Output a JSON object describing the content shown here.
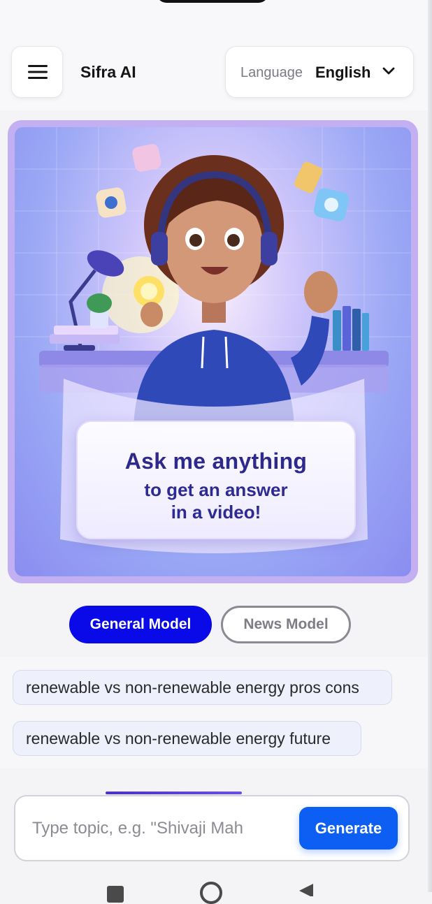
{
  "header": {
    "brand": "Sifra AI",
    "menu_icon": "hamburger-menu-icon",
    "language_label": "Language",
    "language_value": "English",
    "dropdown_icon": "chevron-down-icon"
  },
  "hero": {
    "line1": "Ask me anything",
    "line2": "to get an answer",
    "line3": "in a video!"
  },
  "models": {
    "general_label": "General Model",
    "news_label": "News Model",
    "selected": "General Model"
  },
  "suggestions": [
    "renewable vs non-renewable energy pros cons",
    "renewable vs non-renewable energy future"
  ],
  "input": {
    "placeholder": "Type topic, e.g. \"Shivaji Mah",
    "value": "",
    "generate_label": "Generate"
  },
  "colors": {
    "primary_blue": "#0a0ae8",
    "generate_blue": "#0c5ff2",
    "hero_purple": "#c3b0f2",
    "title_navy": "#2e2a8c"
  }
}
